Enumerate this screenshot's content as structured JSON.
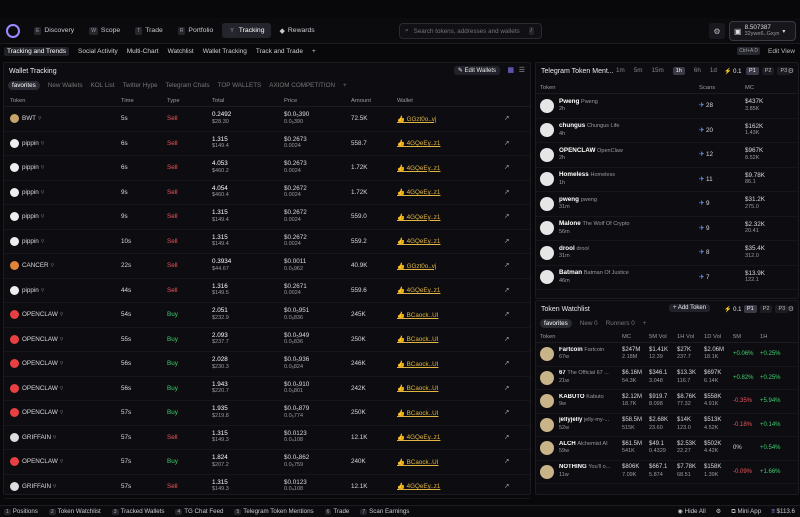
{
  "nav": [
    {
      "key": "E",
      "label": "Discovery"
    },
    {
      "key": "W",
      "label": "Scope"
    },
    {
      "key": "T",
      "label": "Trade"
    },
    {
      "key": "R",
      "label": "Portfolio"
    },
    {
      "key": "Y",
      "label": "Tracking"
    },
    {
      "key": "",
      "label": "Rewards"
    }
  ],
  "search": {
    "placeholder": "Search tokens, addresses and wallets",
    "shortcut": "/"
  },
  "wallet": {
    "balance": "8.507387",
    "address": "32ywe6..Gxyn"
  },
  "subnav": [
    "Tracking and Trends",
    "Social Activity",
    "Multi-Chart",
    "Watchlist",
    "Wallet Tracking",
    "Track and Trade",
    "+"
  ],
  "subnav_right": {
    "shortcut": "Ctrl+A D",
    "edit": "Edit View"
  },
  "wt": {
    "title": "Wallet Tracking",
    "edit_wallets": "Edit Wallets",
    "tabs": [
      "favorites",
      "New Wallets",
      "KOL List",
      "Twitter Hype",
      "Telegram Chats",
      "TOP WALLETS",
      "AXIOM COMPETITION",
      "+"
    ],
    "cols": [
      "Token",
      "Time",
      "Type",
      "Total",
      "Price",
      "Amount",
      "Wallet"
    ],
    "rows": [
      {
        "token": "BWT",
        "time": "5s",
        "type": "Sell",
        "total": "0.2492",
        "total_usd": "$28.30",
        "price": "$0.0₅390",
        "price2": "0.0₆390",
        "amount": "72.5K",
        "wallet": "GGzt0o..vj"
      },
      {
        "token": "pippin",
        "time": "6s",
        "type": "Sell",
        "total": "1.315",
        "total_usd": "$149.4",
        "price": "$0.2673",
        "price2": "0.0024",
        "amount": "558.7",
        "wallet": "4GQeEy..z1"
      },
      {
        "token": "pippin",
        "time": "6s",
        "type": "Sell",
        "total": "4.053",
        "total_usd": "$460.2",
        "price": "$0.2673",
        "price2": "0.0024",
        "amount": "1.72K",
        "wallet": "4GQeEy..z1"
      },
      {
        "token": "pippin",
        "time": "9s",
        "type": "Sell",
        "total": "4.054",
        "total_usd": "$460.4",
        "price": "$0.2672",
        "price2": "0.0024",
        "amount": "1.72K",
        "wallet": "4GQeEy..z1"
      },
      {
        "token": "pippin",
        "time": "9s",
        "type": "Sell",
        "total": "1.315",
        "total_usd": "$149.4",
        "price": "$0.2672",
        "price2": "0.0024",
        "amount": "559.0",
        "wallet": "4GQeEy..z1"
      },
      {
        "token": "pippin",
        "time": "10s",
        "type": "Sell",
        "total": "1.315",
        "total_usd": "$149.4",
        "price": "$0.2672",
        "price2": "0.0024",
        "amount": "559.2",
        "wallet": "4GQeEy..z1"
      },
      {
        "token": "CANCER",
        "time": "22s",
        "type": "Sell",
        "total": "0.3934",
        "total_usd": "$44.67",
        "price": "$0.0011",
        "price2": "0.0₅962",
        "amount": "40.9K",
        "wallet": "GGzt0o..vj"
      },
      {
        "token": "pippin",
        "time": "44s",
        "type": "Sell",
        "total": "1.316",
        "total_usd": "$149.5",
        "price": "$0.2671",
        "price2": "0.0024",
        "amount": "559.6",
        "wallet": "4GQeEy..z1"
      },
      {
        "token": "OPENCLAW",
        "time": "54s",
        "type": "Buy",
        "total": "2.051",
        "total_usd": "$232.9",
        "price": "$0.0₅951",
        "price2": "0.0₆836",
        "amount": "245K",
        "wallet": "BCaock..UI"
      },
      {
        "token": "OPENCLAW",
        "time": "55s",
        "type": "Buy",
        "total": "2.093",
        "total_usd": "$237.7",
        "price": "$0.0₅949",
        "price2": "0.0₆836",
        "amount": "250K",
        "wallet": "BCaock..UI"
      },
      {
        "token": "OPENCLAW",
        "time": "56s",
        "type": "Buy",
        "total": "2.028",
        "total_usd": "$230.3",
        "price": "$0.0₅936",
        "price2": "0.0₆824",
        "amount": "246K",
        "wallet": "BCaock..UI"
      },
      {
        "token": "OPENCLAW",
        "time": "56s",
        "type": "Buy",
        "total": "1.943",
        "total_usd": "$220.7",
        "price": "$0.0₅910",
        "price2": "0.0₆801",
        "amount": "242K",
        "wallet": "BCaock..UI"
      },
      {
        "token": "OPENCLAW",
        "time": "57s",
        "type": "Buy",
        "total": "1.935",
        "total_usd": "$219.8",
        "price": "$0.0₅879",
        "price2": "0.0₆774",
        "amount": "250K",
        "wallet": "BCaock..UI"
      },
      {
        "token": "GRIFFAIN",
        "time": "57s",
        "type": "Sell",
        "total": "1.315",
        "total_usd": "$149.3",
        "price": "$0.0123",
        "price2": "0.0₄108",
        "amount": "12.1K",
        "wallet": "4GQeEy..z1"
      },
      {
        "token": "OPENCLAW",
        "time": "57s",
        "type": "Buy",
        "total": "1.824",
        "total_usd": "$207.2",
        "price": "$0.0₅862",
        "price2": "0.0₆759",
        "amount": "240K",
        "wallet": "BCaock..UI"
      },
      {
        "token": "GRIFFAIN",
        "time": "57s",
        "type": "Sell",
        "total": "1.315",
        "total_usd": "$149.3",
        "price": "$0.0123",
        "price2": "0.0₄108",
        "amount": "12.1K",
        "wallet": "4GQeEy..z1"
      }
    ]
  },
  "tg": {
    "title": "Telegram Token Ment...",
    "times": [
      "1m",
      "5m",
      "15m",
      "1h",
      "6h",
      "1d"
    ],
    "selected_time": "1h",
    "qty": "0.1",
    "presets": [
      "P1",
      "P2",
      "P3"
    ],
    "cols": [
      "Token",
      "Scans",
      "MC"
    ],
    "rows": [
      {
        "ticker": "Pweng",
        "name": "Pweng",
        "age": "2h",
        "scans": "28",
        "mc": "$437K",
        "mc2": "3.85K"
      },
      {
        "ticker": "chungus",
        "name": "Chungus Life",
        "age": "4h",
        "scans": "20",
        "mc": "$162K",
        "mc2": "1.43K"
      },
      {
        "ticker": "OPENCLAW",
        "name": "OpenClaw",
        "age": "2h",
        "scans": "12",
        "mc": "$967K",
        "mc2": "8.52K"
      },
      {
        "ticker": "Homeless",
        "name": "Homeless",
        "age": "1h",
        "scans": "11",
        "mc": "$9.78K",
        "mc2": "86.1"
      },
      {
        "ticker": "pweng",
        "name": "pweng",
        "age": "31m",
        "scans": "9",
        "mc": "$31.2K",
        "mc2": "275.0"
      },
      {
        "ticker": "Malone",
        "name": "The Wolf Of Crypto",
        "age": "56m",
        "scans": "9",
        "mc": "$2.32K",
        "mc2": "20.41"
      },
      {
        "ticker": "drool",
        "name": "drool",
        "age": "31m",
        "scans": "8",
        "mc": "$35.4K",
        "mc2": "312.0"
      },
      {
        "ticker": "Batman",
        "name": "Batman Of Justice",
        "age": "46m",
        "scans": "7",
        "mc": "$13.9K",
        "mc2": "122.1"
      }
    ]
  },
  "tw": {
    "title": "Token Watchlist",
    "add": "Add Token",
    "qty": "0.1",
    "presets": [
      "P1",
      "P2",
      "P3"
    ],
    "tabs": [
      {
        "label": "favorites",
        "count": ""
      },
      {
        "label": "New",
        "count": "0"
      },
      {
        "label": "Runners",
        "count": "0"
      },
      {
        "label": "+",
        "count": ""
      }
    ],
    "cols": [
      "Token",
      "MC",
      "5M Vol",
      "1H Vol",
      "1D Vol",
      "5M",
      "1H"
    ],
    "rows": [
      {
        "ticker": "Fartcoin",
        "name": "Fartcoin",
        "age": "67w",
        "mc": "$247M",
        "mc2": "2.18M",
        "v5": "$1.41K",
        "v5b": "12.39",
        "v1": "$27K",
        "v1b": "237.7",
        "vd": "$2.06M",
        "vdb": "18.1K",
        "p5": "+0.06%",
        "p1": "+0.25%"
      },
      {
        "ticker": "67",
        "name": "The Official 67 ...",
        "age": "21w",
        "mc": "$6.16M",
        "mc2": "54.3K",
        "v5": "$346.1",
        "v5b": "3.048",
        "v1": "$13.3K",
        "v1b": "116.7",
        "vd": "$697K",
        "vdb": "6.14K",
        "p5": "+0.82%",
        "p1": "+0.25%"
      },
      {
        "ticker": "KABUTO",
        "name": "Kabuto",
        "age": "9w",
        "mc": "$2.12M",
        "mc2": "18.7K",
        "v5": "$919.7",
        "v5b": "8.098",
        "v1": "$8.76K",
        "v1b": "77.32",
        "vd": "$558K",
        "vdb": "4.91K",
        "p5": "-0.35%",
        "p1": "+5.94%"
      },
      {
        "ticker": "jellyjelly",
        "name": "jelly-my-...",
        "age": "52w",
        "mc": "$58.5M",
        "mc2": "515K",
        "v5": "$2.68K",
        "v5b": "23.60",
        "v1": "$14K",
        "v1b": "123.0",
        "vd": "$513K",
        "vdb": "4.52K",
        "p5": "-0.18%",
        "p1": "+0.14%"
      },
      {
        "ticker": "ALCH",
        "name": "Alchemist AI",
        "age": "59w",
        "mc": "$61.5M",
        "mc2": "541K",
        "v5": "$49.1",
        "v5b": "0.4329",
        "v1": "$2.53K",
        "v1b": "22.27",
        "vd": "$502K",
        "vdb": "4.42K",
        "p5": "0%",
        "p1": "+0.54%"
      },
      {
        "ticker": "NOTHING",
        "name": "You'll o...",
        "age": "11w",
        "mc": "$806K",
        "mc2": "7.09K",
        "v5": "$667.1",
        "v5b": "5.874",
        "v1": "$7.78K",
        "v1b": "68.51",
        "vd": "$158K",
        "vdb": "1.39K",
        "p5": "-0.09%",
        "p1": "+1.66%"
      }
    ]
  },
  "bottom": [
    {
      "n": "1",
      "label": "Positions"
    },
    {
      "n": "2",
      "label": "Token Watchlist"
    },
    {
      "n": "3",
      "label": "Tracked Wallets"
    },
    {
      "n": "4",
      "label": "TG Chat Feed"
    },
    {
      "n": "5",
      "label": "Telegram Token Mentions"
    },
    {
      "n": "6",
      "label": "Trade"
    },
    {
      "n": "7",
      "label": "Scan Earnings"
    }
  ],
  "bottom_right": {
    "hide": "Hide All",
    "mini": "Mini App",
    "price": "$113.6"
  }
}
